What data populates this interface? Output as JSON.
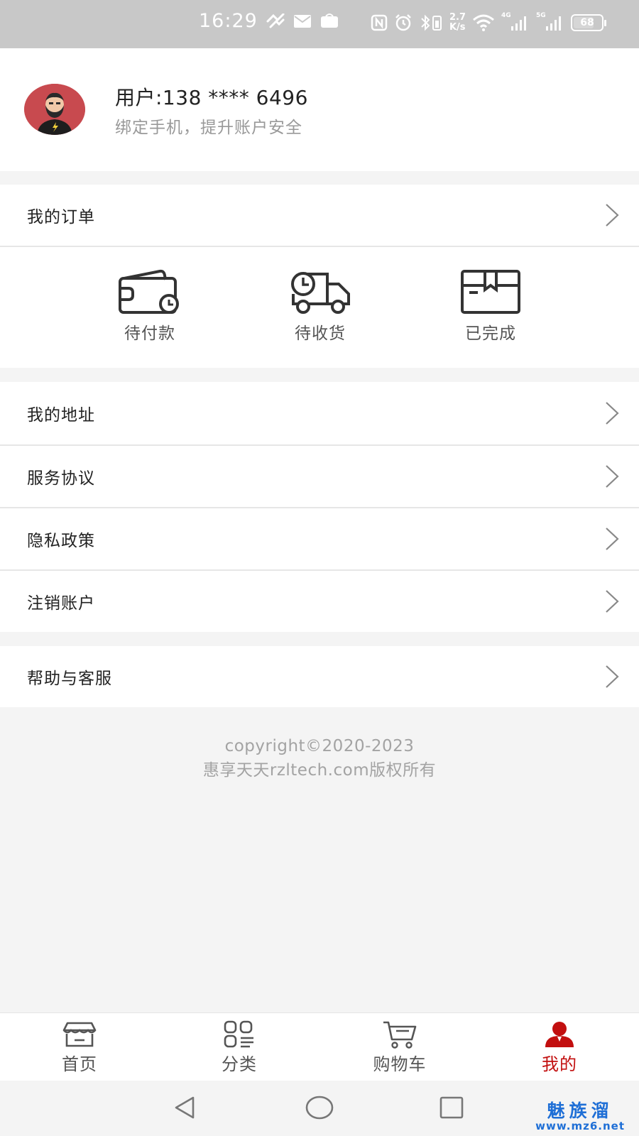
{
  "status_bar": {
    "time": "16:29",
    "speed_value": "2.7",
    "speed_unit": "K/s",
    "net_4g": "4G",
    "net_5g": "5G",
    "battery": "68"
  },
  "profile": {
    "user": "用户:138 **** 6496",
    "subtitle": "绑定手机，提升账户安全"
  },
  "orders": {
    "title": "我的订单",
    "items": [
      {
        "label": "待付款",
        "icon": "wallet-clock-icon"
      },
      {
        "label": "待收货",
        "icon": "delivery-truck-icon"
      },
      {
        "label": "已完成",
        "icon": "package-box-icon"
      }
    ]
  },
  "menu": {
    "address": "我的地址",
    "service_agreement": "服务协议",
    "privacy_policy": "隐私政策",
    "close_account": "注销账户",
    "help": "帮助与客服"
  },
  "footer": {
    "copyright_line1": "copyright©2020-2023",
    "copyright_line2": "惠享天天rzltech.com版权所有"
  },
  "tabs": [
    {
      "label": "首页",
      "icon": "storefront-icon",
      "active": false
    },
    {
      "label": "分类",
      "icon": "category-grid-icon",
      "active": false
    },
    {
      "label": "购物车",
      "icon": "cart-icon",
      "active": false
    },
    {
      "label": "我的",
      "icon": "user-icon",
      "active": true
    }
  ],
  "watermark": {
    "top": "魅族溜",
    "bottom": "www.mz6.net"
  },
  "colors": {
    "accent": "#c20f0f",
    "avatar_bg": "#c84a4f",
    "status_bar": "#c8c8c8",
    "watermark": "#1f6fd6"
  }
}
